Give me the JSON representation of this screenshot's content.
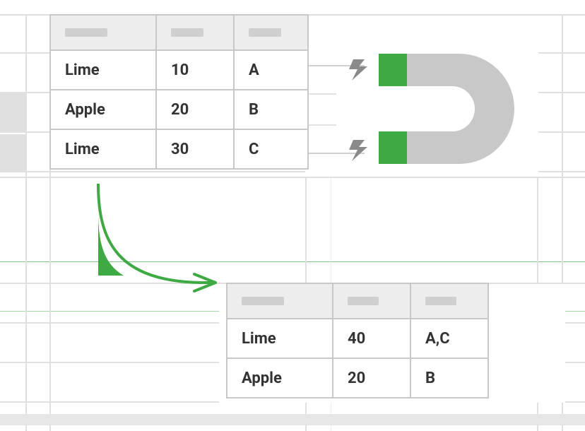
{
  "colors": {
    "grid": "#e0e0e0",
    "green": "#3fa943",
    "magnetBody": "#c8c8c8",
    "bolt": "#8a8a8a",
    "tableBorder": "#c8c8c8",
    "headerFill": "#ededed",
    "text": "#333333"
  },
  "source_table": {
    "headers": [
      "",
      "",
      ""
    ],
    "rows": [
      [
        "Lime",
        "10",
        "A"
      ],
      [
        "Apple",
        "20",
        "B"
      ],
      [
        "Lime",
        "30",
        "C"
      ]
    ]
  },
  "result_table": {
    "headers": [
      "",
      "",
      ""
    ],
    "rows": [
      [
        "Lime",
        "40",
        "A,C"
      ],
      [
        "Apple",
        "20",
        "B"
      ]
    ]
  },
  "icons": {
    "magnet": "magnet-icon",
    "bolt_top": "bolt-icon",
    "bolt_bottom": "bolt-icon",
    "arrow": "arrow-icon"
  }
}
